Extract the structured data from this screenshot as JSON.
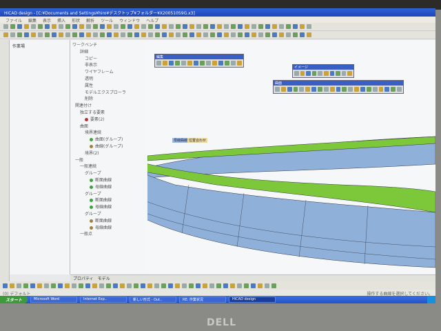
{
  "window": {
    "title": "HiCAD design - [C:¥Documents and Settings¥hiro¥デスクトップ¥フォルダー¥X20051059G.x3]"
  },
  "menu": [
    "ファイル",
    "編集",
    "表示",
    "挿入",
    "形状",
    "解析",
    "ツール",
    "ウィンドウ",
    "ヘルプ"
  ],
  "left_panel": {
    "label": "作業場"
  },
  "tree": {
    "root": "ワークベンチ",
    "items": [
      {
        "label": "詳細",
        "indent": 1
      },
      {
        "label": "コピー",
        "indent": 2
      },
      {
        "label": "非表示",
        "indent": 2
      },
      {
        "label": "ワイヤフレーム",
        "indent": 2
      },
      {
        "label": "透明",
        "indent": 2
      },
      {
        "label": "属性",
        "indent": 2
      },
      {
        "label": "モデルエクスプローラ",
        "indent": 2
      },
      {
        "label": "削除",
        "indent": 2
      },
      {
        "label": "関連付け",
        "indent": 0
      },
      {
        "label": "独立する要素",
        "indent": 1
      },
      {
        "label": "要素(2)",
        "indent": 2,
        "dot": "#c03030"
      },
      {
        "label": "曲面",
        "indent": 1
      },
      {
        "label": "境界連続",
        "indent": 2
      },
      {
        "label": "曲面(グループ)",
        "indent": 3,
        "dot": "#40a040"
      },
      {
        "label": "曲線(グループ)",
        "indent": 3,
        "dot": "#a08040"
      },
      {
        "label": "境界(2)",
        "indent": 2
      },
      {
        "label": "一般",
        "indent": 0
      },
      {
        "label": "一般連続",
        "indent": 1
      },
      {
        "label": "グループ",
        "indent": 2
      },
      {
        "label": "断面曲線",
        "indent": 3,
        "dot": "#40a040"
      },
      {
        "label": "母線曲線",
        "indent": 3,
        "dot": "#40a040"
      },
      {
        "label": "グループ",
        "indent": 2
      },
      {
        "label": "断面曲線",
        "indent": 3,
        "dot": "#40a040"
      },
      {
        "label": "母線曲線",
        "indent": 3,
        "dot": "#40a040"
      },
      {
        "label": "グループ",
        "indent": 2
      },
      {
        "label": "断面曲線",
        "indent": 3,
        "dot": "#a08040"
      },
      {
        "label": "母線曲線",
        "indent": 3,
        "dot": "#a08040"
      },
      {
        "label": "一般点",
        "indent": 1
      }
    ]
  },
  "floating_toolbars": [
    {
      "title": "編集"
    },
    {
      "title": "イメージ"
    },
    {
      "title": "曲面"
    }
  ],
  "viewport": {
    "tag_left": "母線曲線",
    "tag_right": "位置合わせ"
  },
  "tabs": [
    "プロパティ",
    "モデル"
  ],
  "layer_field": "(0) デフォルト",
  "status": {
    "message": "操作する曲線を選択してください。"
  },
  "taskbar": {
    "start": "スタート",
    "tasks": [
      "Microsoft Word",
      "Internet Exp..",
      "新しい形式 - Out..",
      "RE: 作業状況",
      "HiCAD design"
    ],
    "active": 4
  },
  "brand": "DELL",
  "colors": {
    "surface_green": "#7cc83a",
    "surface_blue": "#8fb0d8",
    "titlebar": "#2457c8"
  }
}
